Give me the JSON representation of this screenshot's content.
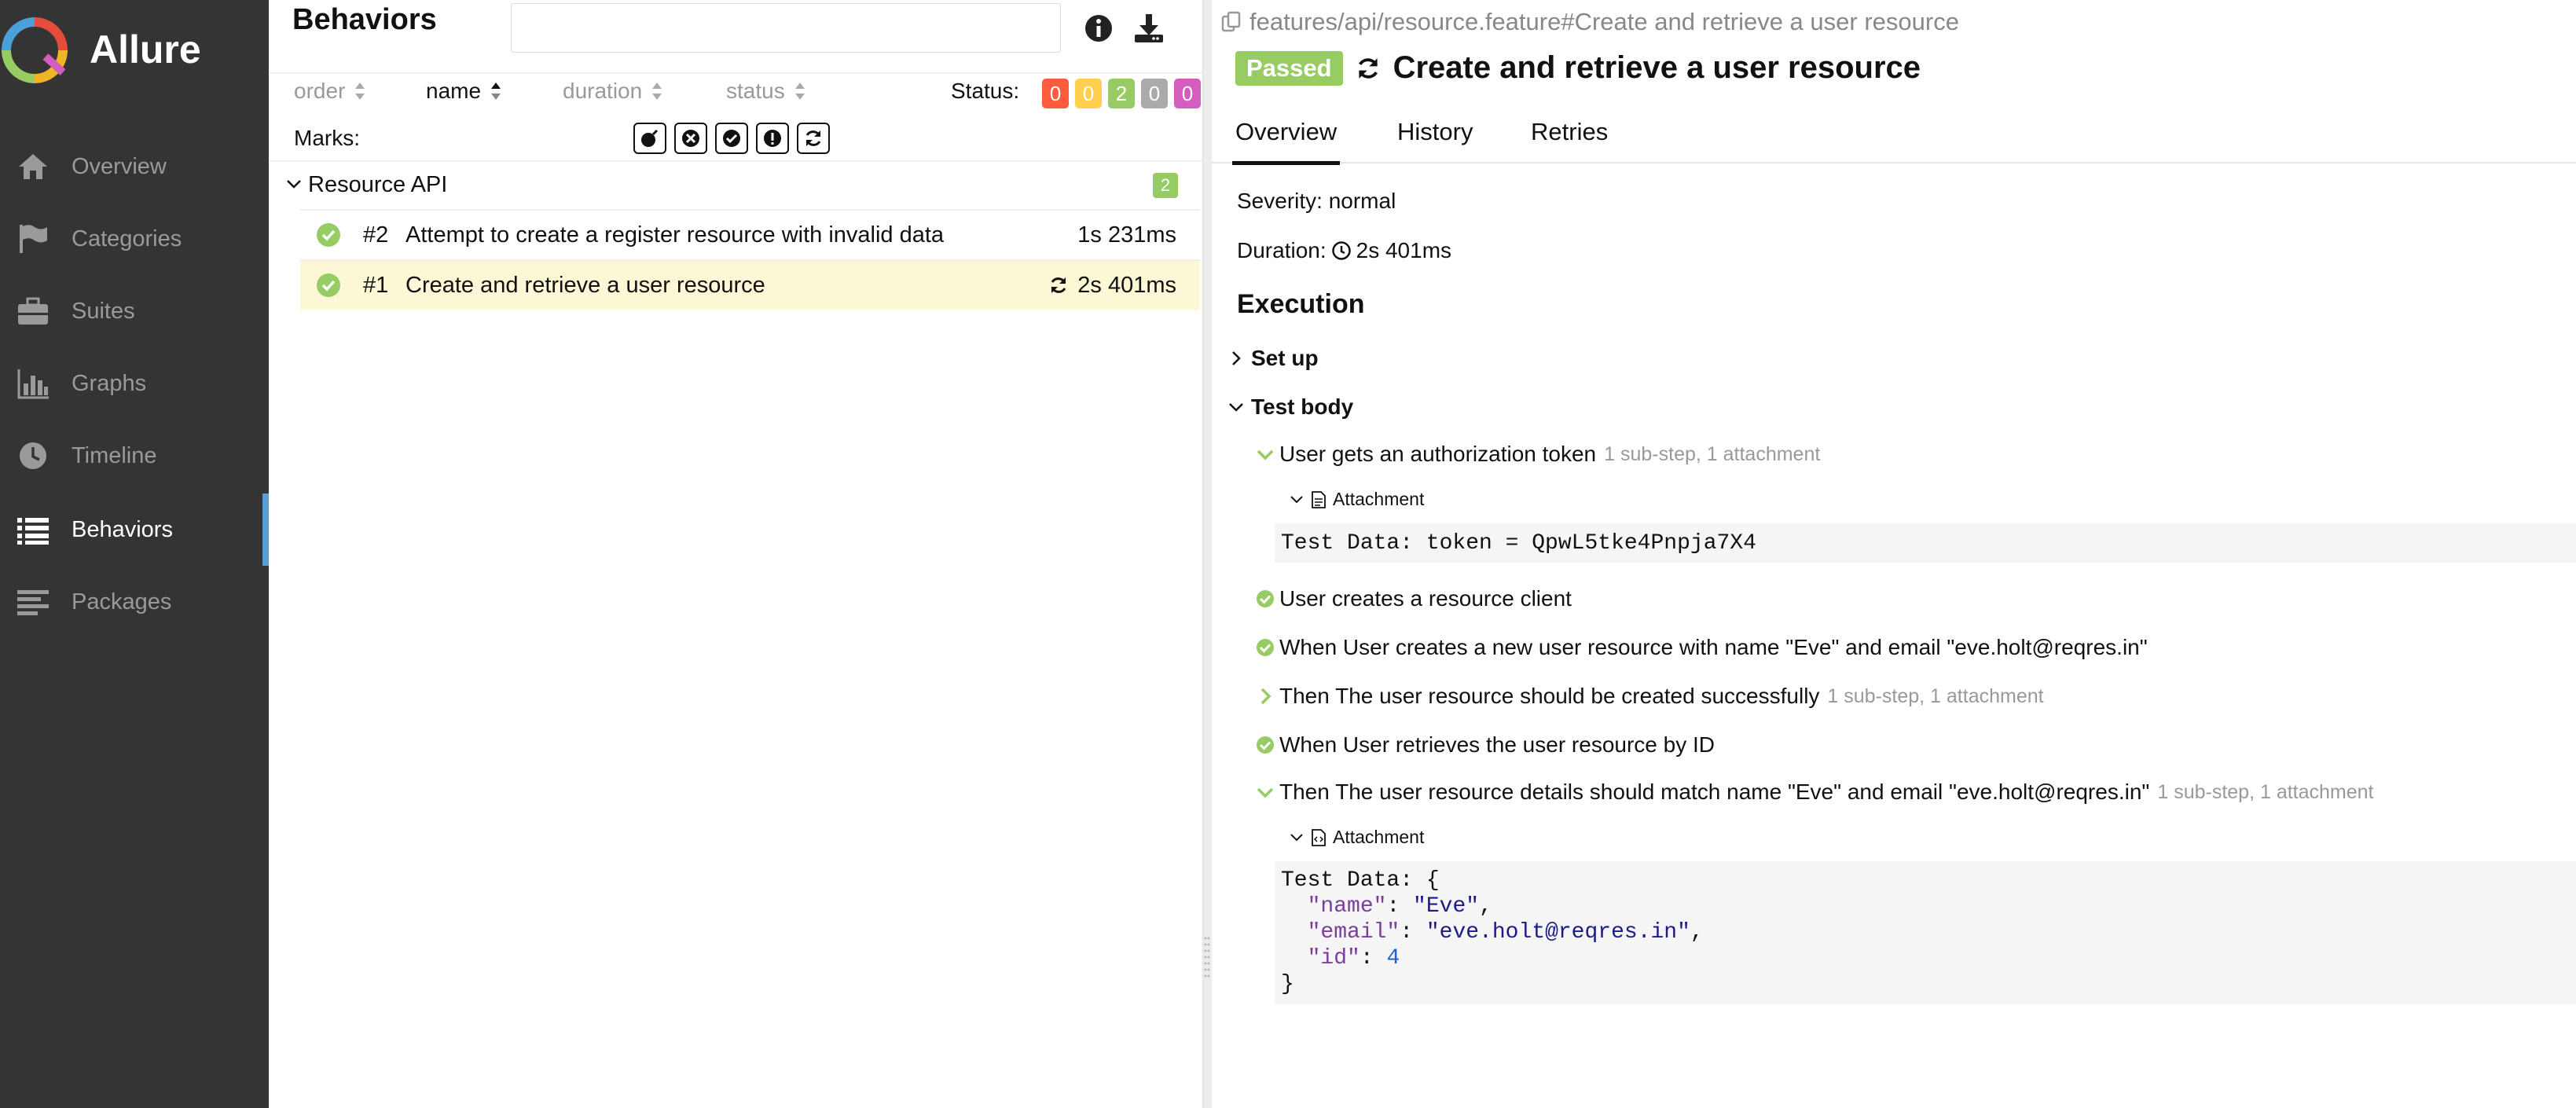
{
  "sidebar": {
    "brand": "Allure",
    "items": [
      {
        "label": "Overview",
        "icon": "home-icon"
      },
      {
        "label": "Categories",
        "icon": "flag-icon"
      },
      {
        "label": "Suites",
        "icon": "briefcase-icon"
      },
      {
        "label": "Graphs",
        "icon": "bar-chart-icon"
      },
      {
        "label": "Timeline",
        "icon": "clock-icon"
      },
      {
        "label": "Behaviors",
        "icon": "list-icon",
        "active": true
      },
      {
        "label": "Packages",
        "icon": "align-left-icon"
      }
    ]
  },
  "list": {
    "title": "Behaviors",
    "search": {
      "value": "",
      "placeholder": ""
    },
    "sort": {
      "order": "order",
      "name": "name",
      "duration": "duration",
      "status": "status"
    },
    "status_label": "Status:",
    "status_counts": [
      {
        "value": "0",
        "color": "#fd5a3e",
        "name": "failed"
      },
      {
        "value": "0",
        "color": "#ffd050",
        "name": "broken"
      },
      {
        "value": "2",
        "color": "#97cc64",
        "name": "passed"
      },
      {
        "value": "0",
        "color": "#aaaaaa",
        "name": "skipped"
      },
      {
        "value": "0",
        "color": "#d35ebe",
        "name": "unknown"
      }
    ],
    "marks_label": "Marks:",
    "group": {
      "name": "Resource API",
      "count": "2"
    },
    "tests": [
      {
        "num": "#2",
        "name": "Attempt to create a register resource with invalid data",
        "duration": "1s 231ms",
        "retried": false
      },
      {
        "num": "#1",
        "name": "Create and retrieve a user resource",
        "duration": "2s 401ms",
        "retried": true,
        "selected": true
      }
    ]
  },
  "detail": {
    "breadcrumb": "features/api/resource.feature#Create and retrieve a user resource",
    "status": "Passed",
    "title": "Create and retrieve a user resource",
    "tabs": [
      "Overview",
      "History",
      "Retries"
    ],
    "severity": "Severity: normal",
    "duration_label": "Duration:",
    "duration_value": "2s 401ms",
    "execution_heading": "Execution",
    "setup_label": "Set up",
    "test_body_label": "Test body",
    "steps": [
      {
        "text": "User gets an authorization token",
        "meta": "1 sub-step, 1 attachment"
      },
      {
        "text": "User creates a resource client",
        "meta": ""
      },
      {
        "text": "When User creates a new user resource with name \"Eve\" and email \"eve.holt@reqres.in\"",
        "meta": ""
      },
      {
        "text": "Then The user resource should be created successfully",
        "meta": "1 sub-step, 1 attachment"
      },
      {
        "text": "When User retrieves the user resource by ID",
        "meta": ""
      },
      {
        "text": "Then The user resource details should match name \"Eve\" and email \"eve.holt@reqres.in\"",
        "meta": "1 sub-step, 1 attachment"
      }
    ],
    "attachment_label": "Attachment",
    "token_text": "Test Data: token = QpwL5tke4Pnpja7X4",
    "json_prefix": "Test Data: {",
    "json_name_key": "\"name\"",
    "json_name_val": "\"Eve\"",
    "json_email_key": "\"email\"",
    "json_email_val": "\"eve.holt@reqres.in\"",
    "json_id_key": "\"id\"",
    "json_id_val": "4",
    "json_close": "}"
  }
}
